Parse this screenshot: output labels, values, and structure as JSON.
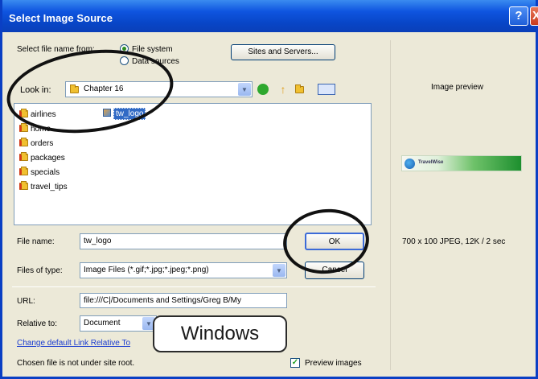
{
  "window": {
    "title": "Select Image Source",
    "help_glyph": "?",
    "close_glyph": "X"
  },
  "select_from": {
    "label": "Select file name from:",
    "options": [
      {
        "label": "File system",
        "selected": true
      },
      {
        "label": "Data sources",
        "selected": false
      }
    ],
    "sites_button": "Sites and Servers..."
  },
  "look_in": {
    "label": "Look in:",
    "value": "Chapter 16"
  },
  "files": [
    {
      "name": "airlines",
      "type": "folder"
    },
    {
      "name": "home",
      "type": "folder"
    },
    {
      "name": "orders",
      "type": "folder"
    },
    {
      "name": "packages",
      "type": "folder"
    },
    {
      "name": "specials",
      "type": "folder"
    },
    {
      "name": "travel_tips",
      "type": "folder"
    },
    {
      "name": "tw_logo",
      "type": "image",
      "selected": true
    }
  ],
  "file_name": {
    "label": "File name:",
    "value": "tw_logo"
  },
  "files_of_type": {
    "label": "Files of type:",
    "value": "Image Files (*.gif;*.jpg;*.jpeg;*.png)"
  },
  "ok_button": "OK",
  "cancel_button": "Cancel",
  "url": {
    "label": "URL:",
    "value": "file:///C|/Documents and Settings/Greg B/My"
  },
  "relative_to": {
    "label": "Relative to:",
    "value": "Document"
  },
  "change_link": "Change default Link Relative To",
  "root_note": "Chosen file is not under site root.",
  "preview_images": {
    "label": "Preview images",
    "checked": true
  },
  "preview": {
    "label": "Image preview",
    "logo_text": "TravelWise",
    "info": "700 x 100 JPEG, 12K / 2 sec"
  },
  "overlay_label": "Windows",
  "colors": {
    "titlebar": "#0f55e0",
    "dialog_bg": "#ece9d8",
    "selection": "#316ac5",
    "annotation_ring": "#111111"
  }
}
